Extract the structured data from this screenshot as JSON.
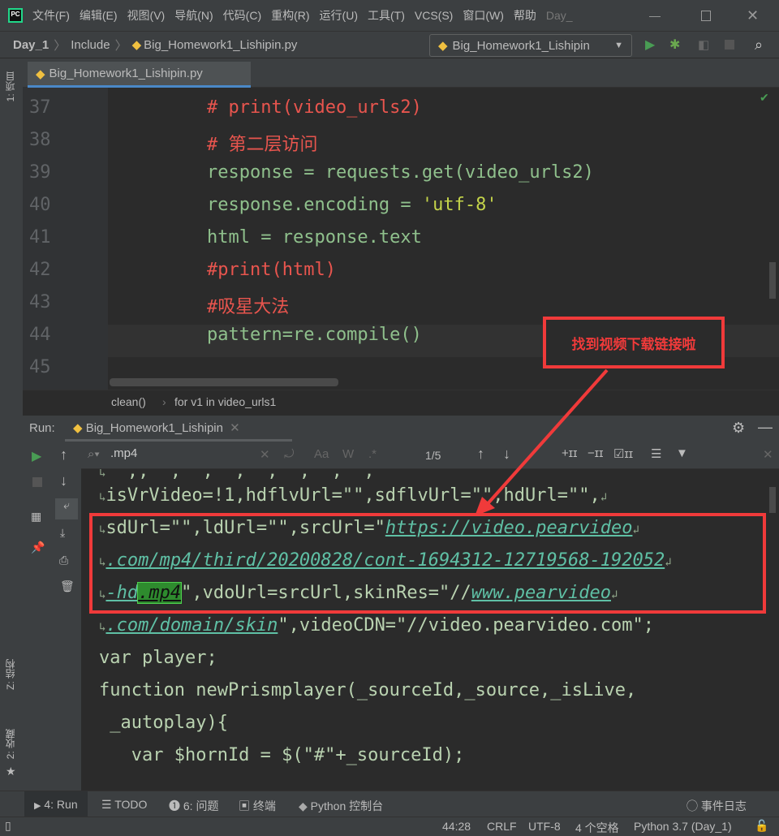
{
  "titlebar": {
    "menus": [
      "文件(F)",
      "编辑(E)",
      "视图(V)",
      "导航(N)",
      "代码(C)",
      "重构(R)",
      "运行(U)",
      "工具(T)",
      "VCS(S)",
      "窗口(W)",
      "帮助"
    ],
    "project": "Day_"
  },
  "navbar": {
    "crumbs": [
      "Day_1",
      "Include",
      "Big_Homework1_Lishipin.py"
    ],
    "run_config": "Big_Homework1_Lishipin"
  },
  "sidebar": {
    "project": "1: 项目",
    "structure": "Z: 结构",
    "favorites": "2: 收藏"
  },
  "editor": {
    "tab": "Big_Homework1_Lishipin.py",
    "lines": [
      {
        "n": "37",
        "text": "# print(video_urls2)",
        "kind": "cm"
      },
      {
        "n": "38",
        "text": "# 第二层访问",
        "kind": "cm"
      },
      {
        "n": "39",
        "text": "response = requests.get(video_urls2)",
        "kind": "pl"
      },
      {
        "n": "40",
        "pre": "response.encoding = ",
        "str": "'utf-8'",
        "kind": "mix"
      },
      {
        "n": "41",
        "text": "html = response.text",
        "kind": "pl"
      },
      {
        "n": "42",
        "text": "#print(html)",
        "kind": "cm"
      },
      {
        "n": "43",
        "text": "#吸星大法",
        "kind": "cm"
      },
      {
        "n": "44",
        "text": "pattern=re.compile()",
        "kind": "pl"
      },
      {
        "n": "45",
        "text": "",
        "kind": "pl"
      }
    ],
    "breadcrumbs": [
      "clean()",
      "for v1 in video_urls1"
    ]
  },
  "annotation": {
    "text": "找到视频下载链接啦",
    "color": "#f03a3a"
  },
  "run": {
    "label": "Run:",
    "tab": "Big_Homework1_Lishipin",
    "search": ".mp4",
    "match_count": "1/5",
    "case_label": "Aa",
    "word_label": "W",
    "regex_label": ".*"
  },
  "console": {
    "l1": "isVrVideo=!1,hdflvUrl=\"\",sdflvUrl=\"\",hdUrl=\"\",",
    "l2a": "sdUrl=\"\",ldUrl=\"\",srcUrl=\"",
    "l2b": "https://video.pearvideo",
    "l3": ".com/mp4/third/20200828/cont-1694312-12719568-192052",
    "l4a": "-hd",
    "l4b": ".mp4",
    "l4c": "\",vdoUrl=srcUrl,skinRes=\"//",
    "l4d": "www.pearvideo",
    "l5a": ".com/domain/skin",
    "l5b": "\",videoCDN=\"//video.pearvideo.com\";",
    "l6": "var player;",
    "l7": "function newPrismplayer(_sourceId,_source,_isLive,",
    "l8": " _autoplay){",
    "l9": "   var $hornId = $(\"#\"+_sourceId);"
  },
  "bottombar": {
    "run": "4: Run",
    "todo": "TODO",
    "problems": "6: 问题",
    "terminal": "终端",
    "console": "Python 控制台",
    "events": "事件日志"
  },
  "status": {
    "position": "44:28",
    "line_sep": "CRLF",
    "encoding": "UTF-8",
    "indent": "4 个空格",
    "interpreter": "Python 3.7 (Day_1)"
  }
}
